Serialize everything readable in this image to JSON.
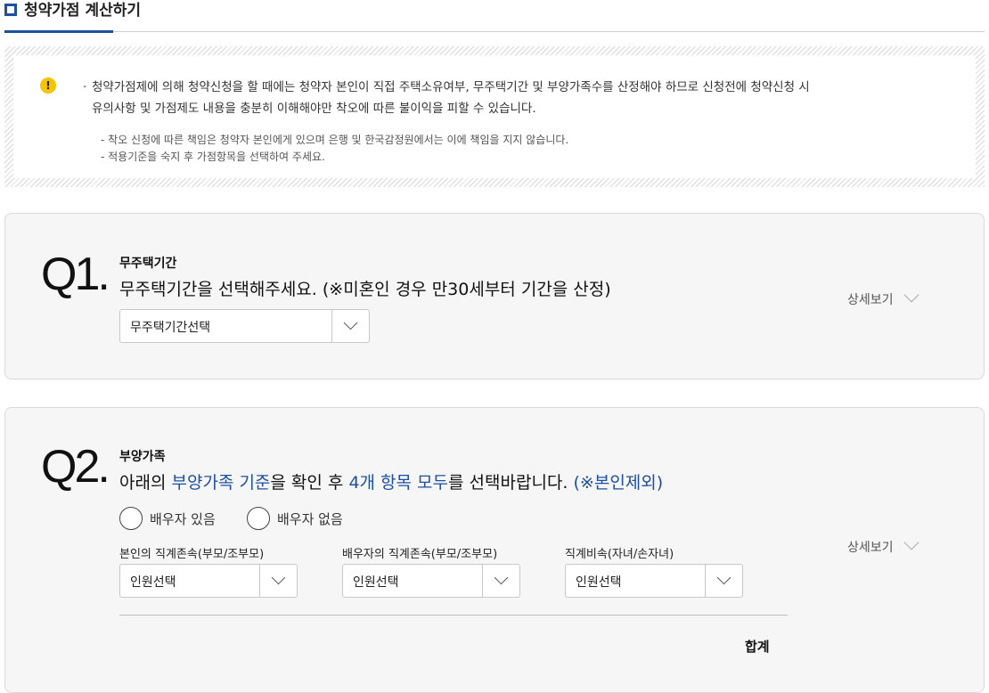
{
  "page": {
    "title": "청약가점 계산하기"
  },
  "notice": {
    "main_bullet": "·",
    "main_line1": "청약가점제에 의해 청약신청을 할 때에는 청약자 본인이 직접 주택소유여부, 무주택기간 및 부양가족수를 산정해야 하므로 신청전에 청약신청 시",
    "main_line2": "유의사항 및 가점제도 내용을 충분히 이해해야만 착오에 따른 불이익을 피할 수 있습니다.",
    "sub1": "- 착오 신청에 따른 책임은 청약자 본인에게 있으며 은행 및 한국감정원에서는 이에 책임을 지지 않습니다.",
    "sub2": "- 적용기준을 숙지 후 가점항목을 선택하여 주세요.",
    "icon": "warning-icon"
  },
  "q1": {
    "number": "Q1.",
    "subtitle": "무주택기간",
    "question": "무주택기간을 선택해주세요. (※미혼인 경우 만30세부터 기간을 산정)",
    "select_value": "무주택기간선택",
    "detail_label": "상세보기"
  },
  "q2": {
    "number": "Q2.",
    "subtitle": "부양가족",
    "question_parts": {
      "p1": "아래의 ",
      "p2": "부양가족 기준",
      "p3": "을 확인 후 ",
      "p4": "4개 항목 모두",
      "p5": "를 선택바랍니다. ",
      "p6": "(※본인제외)"
    },
    "radio_spouse_yes": "배우자 있음",
    "radio_spouse_no": "배우자 없음",
    "fields": [
      {
        "label": "본인의 직계존속(부모/조부모)",
        "value": "인원선택"
      },
      {
        "label": "배우자의 직계존속(부모/조부모)",
        "value": "인원선택"
      },
      {
        "label": "직계비속(자녀/손자녀)",
        "value": "인원선택"
      }
    ],
    "detail_label": "상세보기",
    "total_label": "합계"
  },
  "colors": {
    "accent": "#1e4fa1",
    "warning": "#f4c400",
    "card_bg": "#f6f6f6"
  }
}
